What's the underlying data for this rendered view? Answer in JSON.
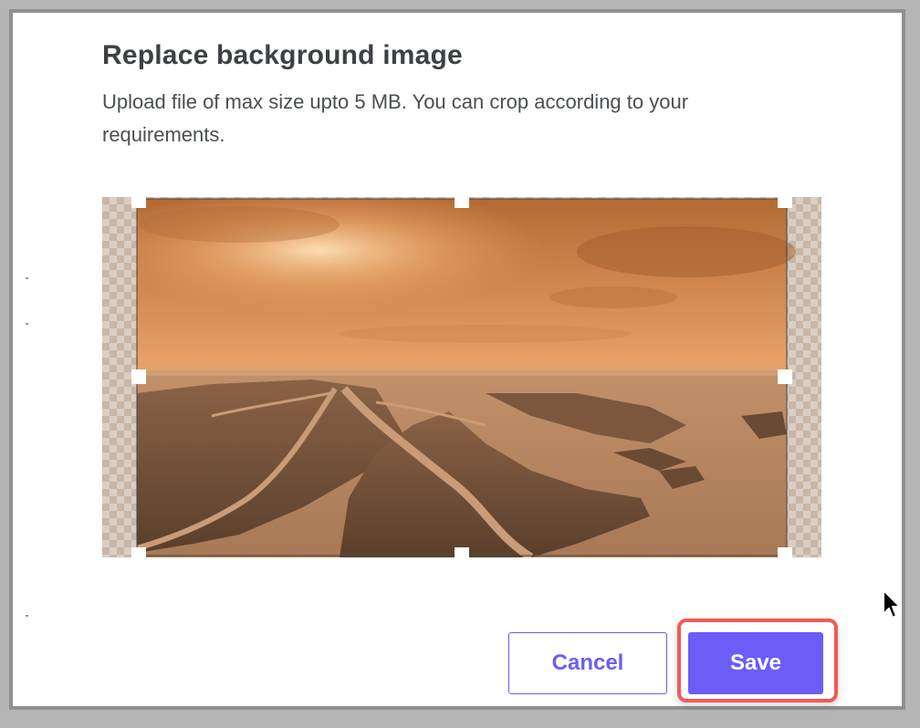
{
  "dialog": {
    "title": "Replace background image",
    "description": "Upload file of max size upto 5 MB. You can crop according to your requirements."
  },
  "cropper": {
    "image_icon": "landscape-photo"
  },
  "actions": {
    "cancel_label": "Cancel",
    "save_label": "Save"
  },
  "colors": {
    "accent": "#6a5ef6",
    "highlight": "#ef5b56"
  }
}
